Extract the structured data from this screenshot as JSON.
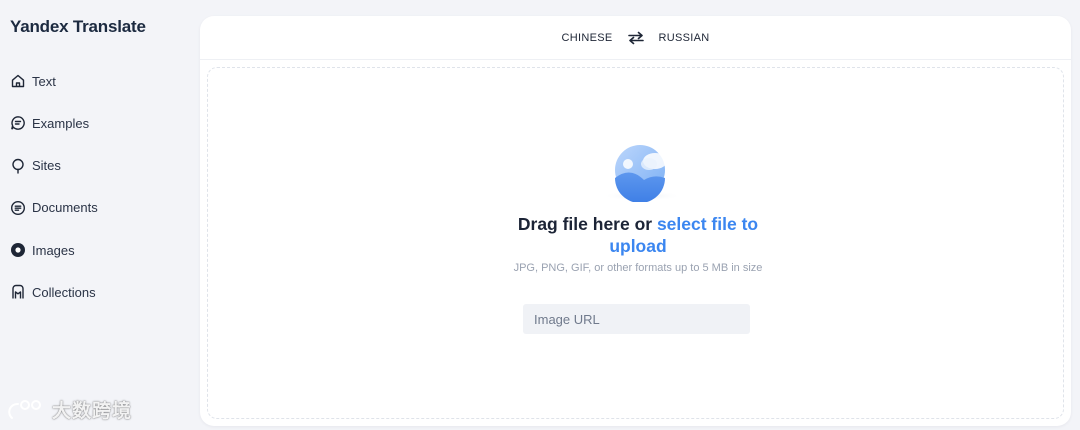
{
  "app": {
    "title": "Yandex Translate"
  },
  "sidebar": {
    "items": [
      {
        "label": "Text",
        "icon": "home-icon"
      },
      {
        "label": "Examples",
        "icon": "chat-bubble-icon"
      },
      {
        "label": "Sites",
        "icon": "pin-icon"
      },
      {
        "label": "Documents",
        "icon": "document-icon"
      },
      {
        "label": "Images",
        "icon": "image-icon",
        "active": true
      },
      {
        "label": "Collections",
        "icon": "bookmark-icon"
      }
    ]
  },
  "language_bar": {
    "source": "CHINESE",
    "target": "RUSSIAN",
    "swap_icon": "swap-arrows-icon"
  },
  "upload": {
    "headline_plain": "Drag file here or ",
    "headline_link": "select file to upload",
    "hint": "JPG, PNG, GIF, or other formats up to 5 MB in size",
    "url_placeholder": "Image URL"
  },
  "watermark": {
    "text": "大数跨境"
  },
  "colors": {
    "accent": "#3b86f0",
    "background": "#f3f4f8",
    "panel": "#ffffff"
  }
}
